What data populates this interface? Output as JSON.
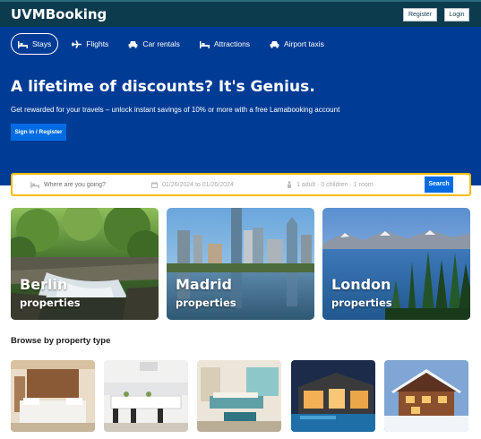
{
  "header": {
    "brand": "UVMBooking",
    "register_label": "Register",
    "login_label": "Login"
  },
  "nav": {
    "items": [
      {
        "label": "Stays",
        "icon": "bed-icon",
        "active": true
      },
      {
        "label": "Flights",
        "icon": "plane-icon",
        "active": false
      },
      {
        "label": "Car rentals",
        "icon": "car-icon",
        "active": false
      },
      {
        "label": "Attractions",
        "icon": "bed-icon",
        "active": false
      },
      {
        "label": "Airport taxis",
        "icon": "taxi-icon",
        "active": false
      }
    ]
  },
  "hero": {
    "title": "A lifetime of discounts? It's Genius.",
    "subtitle": "Get rewarded for your travels – unlock instant savings of 10% or more with a free Lamabooking account",
    "cta_label": "Sign in / Register"
  },
  "search": {
    "destination_placeholder": "Where are you going?",
    "dates": "01/26/2024 to 01/26/2024",
    "guests": "1 adult · 0 children · 1 room",
    "button_label": "Search"
  },
  "featured": {
    "cities": [
      {
        "name": "Berlin",
        "sub": "properties"
      },
      {
        "name": "Madrid",
        "sub": "properties"
      },
      {
        "name": "London",
        "sub": "properties"
      }
    ]
  },
  "property_types": {
    "title": "Browse by property type"
  },
  "colors": {
    "header_bg": "#0d3b4e",
    "hero_bg": "#003b95",
    "accent_blue": "#006ce4",
    "search_border": "#febb02"
  }
}
